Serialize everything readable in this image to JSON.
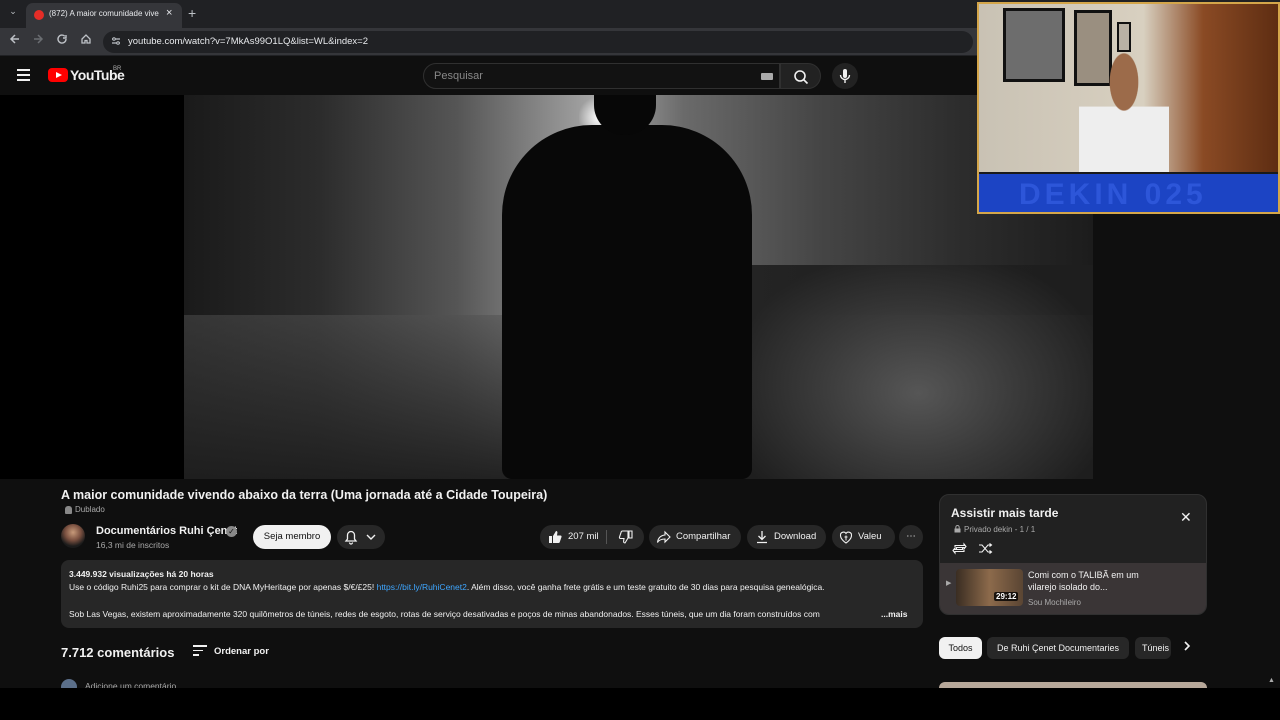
{
  "browser": {
    "tab_title": "(872) A maior comunidade vive",
    "tab_close": "×",
    "new_tab": "+",
    "tabs_menu": "⌄",
    "url": "youtube.com/watch?v=7MkAs99O1LQ&list=WL&index=2",
    "icons": [
      "back-icon",
      "forward-icon",
      "reload-icon",
      "home-icon",
      "site-info-icon"
    ]
  },
  "youtube": {
    "logo_text": "YouTube",
    "region": "BR",
    "search_placeholder": "Pesquisar"
  },
  "webcam": {
    "band_text": "DEKIN  025"
  },
  "video": {
    "title": "A maior comunidade vivendo abaixo da terra (Uma jornada até a Cidade Toupeira)",
    "dubbed_label": "Dublado",
    "channel": "Documentários Ruhi Çenet",
    "subscribers": "16,3 mi de inscritos",
    "join_label": "Seja membro",
    "likes": "207 mil",
    "share_label": "Compartilhar",
    "download_label": "Download",
    "thanks_label": "Valeu",
    "more_actions": "⋯"
  },
  "description": {
    "meta": "3.449.932 visualizações  há 20 horas",
    "line1_pre": "Use o código Ruhi25 para comprar o kit de DNA MyHeritage por apenas $/€/£25! ",
    "line1_link": "https://bit.ly/RuhiCenet2",
    "line1_post": ". Além disso, você ganha frete grátis e um teste gratuito de 30 dias para pesquisa genealógica.",
    "line2": "Sob Las Vegas, existem aproximadamente 320 quilômetros de túneis, redes de esgoto, rotas de serviço desativadas e poços de minas abandonados. Esses túneis, que um dia foram construídos com",
    "more": "...mais"
  },
  "comments": {
    "count": "7.712 comentários",
    "sort_label": "Ordenar por",
    "add_placeholder": "Adicione um comentário..."
  },
  "playlist": {
    "title": "Assistir mais tarde",
    "meta": "Privado  dekin - 1 / 1",
    "close": "✕",
    "item": {
      "title": "Comi com o TALIBÃ em um vilarejo isolado do...",
      "duration": "29:12",
      "channel": "Sou Mochileiro"
    }
  },
  "chips": [
    {
      "label": "Todos",
      "selected": true
    },
    {
      "label": "De Ruhi Çenet Documentaries",
      "selected": false
    },
    {
      "label": "Túneis",
      "selected": false
    }
  ],
  "colors": {
    "youtube_red": "#ff0000",
    "background": "#0f0f0f",
    "link": "#3ea6ff",
    "webcam_border": "#d4a64a",
    "webcam_band": "#1c44c4"
  }
}
